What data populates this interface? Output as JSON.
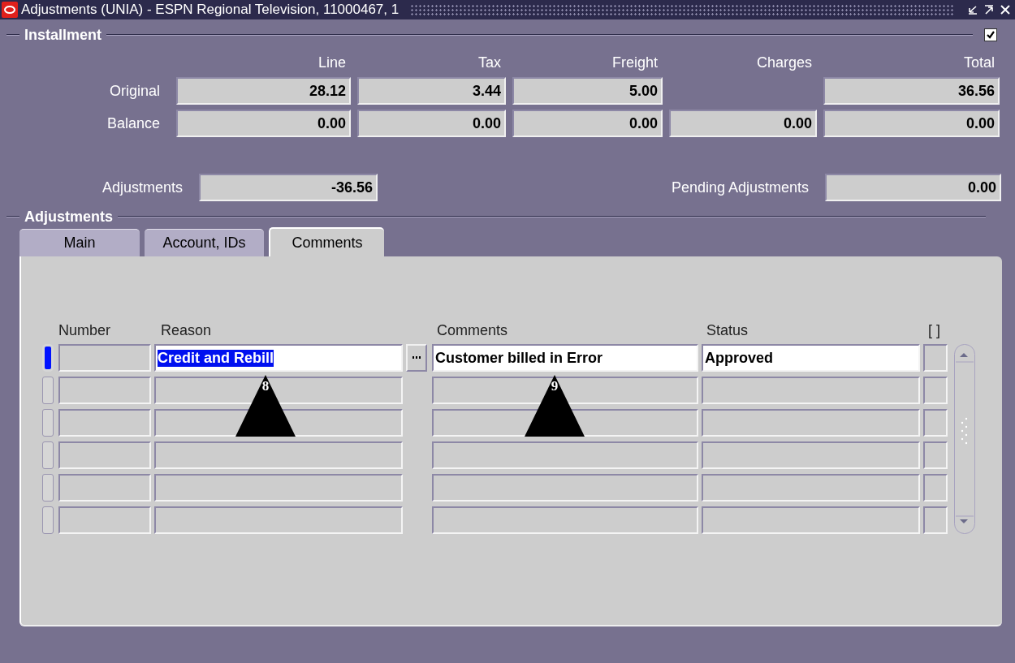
{
  "window": {
    "title": "Adjustments (UNIA) - ESPN Regional Television, 11000467, 1"
  },
  "installment": {
    "title": "Installment",
    "checked": true,
    "columns": [
      "Line",
      "Tax",
      "Freight",
      "Charges",
      "Total"
    ],
    "rows": [
      {
        "label": "Original",
        "values": {
          "line": "28.12",
          "tax": "3.44",
          "freight": "5.00",
          "total": "36.56"
        }
      },
      {
        "label": "Balance",
        "values": {
          "line": "0.00",
          "tax": "0.00",
          "freight": "0.00",
          "charges": "0.00",
          "total": "0.00"
        }
      }
    ],
    "adjustments_label": "Adjustments",
    "adjustments": "-36.56",
    "pending_label": "Pending Adjustments",
    "pending": "0.00"
  },
  "adjustments": {
    "title": "Adjustments",
    "tabs": [
      {
        "label": "Main",
        "selected": false
      },
      {
        "label": "Account, IDs",
        "selected": false
      },
      {
        "label": "Comments",
        "selected": true
      }
    ],
    "columns": [
      "Number",
      "Reason",
      "Comments",
      "Status",
      "[ ]"
    ],
    "rows": [
      {
        "current": true,
        "reason": "Credit and Rebill",
        "reason_highlighted": true,
        "comments": "Customer billed in Error",
        "status": "Approved"
      },
      {
        "current": false
      },
      {
        "current": false
      },
      {
        "current": false
      },
      {
        "current": false
      },
      {
        "current": false
      }
    ]
  },
  "callouts": [
    {
      "label": "8"
    },
    {
      "label": "9"
    }
  ]
}
